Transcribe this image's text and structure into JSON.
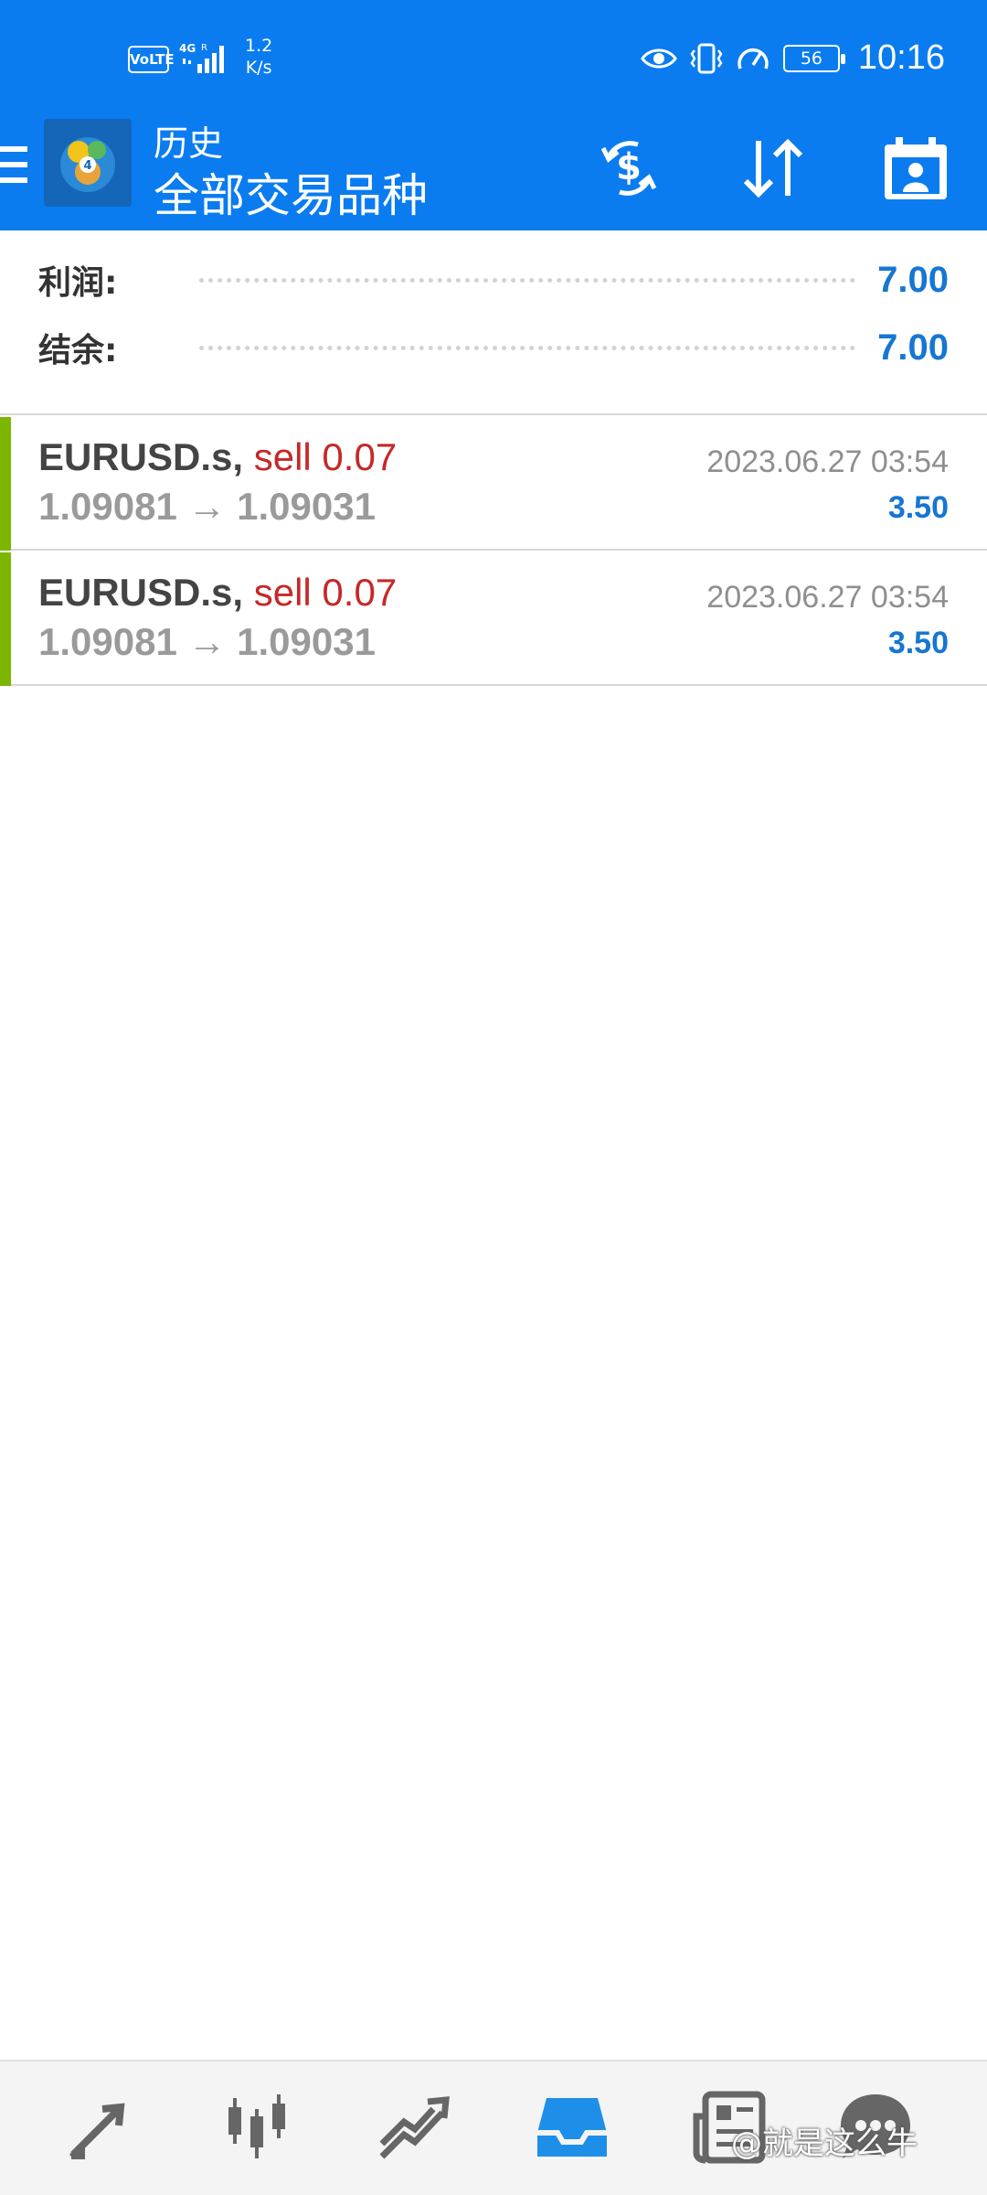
{
  "status_bar": {
    "volte": "VoLTE",
    "network": "4G R",
    "net_speed_value": "1.2",
    "net_speed_unit": "K/s",
    "battery": "56",
    "time": "10:16"
  },
  "app_bar": {
    "subtitle": "历史",
    "title": "全部交易品种",
    "icons": [
      "menu-icon",
      "metatrader-logo",
      "deposit-withdraw-icon",
      "sort-icon",
      "period-icon"
    ]
  },
  "summary": {
    "profit_label": "利润:",
    "profit_value": "7.00",
    "balance_label": "结余:",
    "balance_value": "7.00"
  },
  "deals": [
    {
      "symbol": "EURUSD.s,",
      "type_volume": "sell 0.07",
      "prices": "1.09081 → 1.09031",
      "datetime": "2023.06.27 03:54",
      "profit": "3.50"
    },
    {
      "symbol": "EURUSD.s,",
      "type_volume": "sell 0.07",
      "prices": "1.09081 → 1.09031",
      "datetime": "2023.06.27 03:54",
      "profit": "3.50"
    }
  ],
  "bottom_nav": {
    "items": [
      "quotes-icon",
      "chart-icon",
      "trade-icon",
      "history-icon",
      "news-icon",
      "chat-icon"
    ],
    "active": "history-icon"
  },
  "watermark": "@就是这么牛",
  "colors": {
    "header": "#0A7CF0",
    "accent_blue": "#1676D2",
    "sell_red": "#C62828",
    "deal_bar_green": "#7DB600"
  }
}
